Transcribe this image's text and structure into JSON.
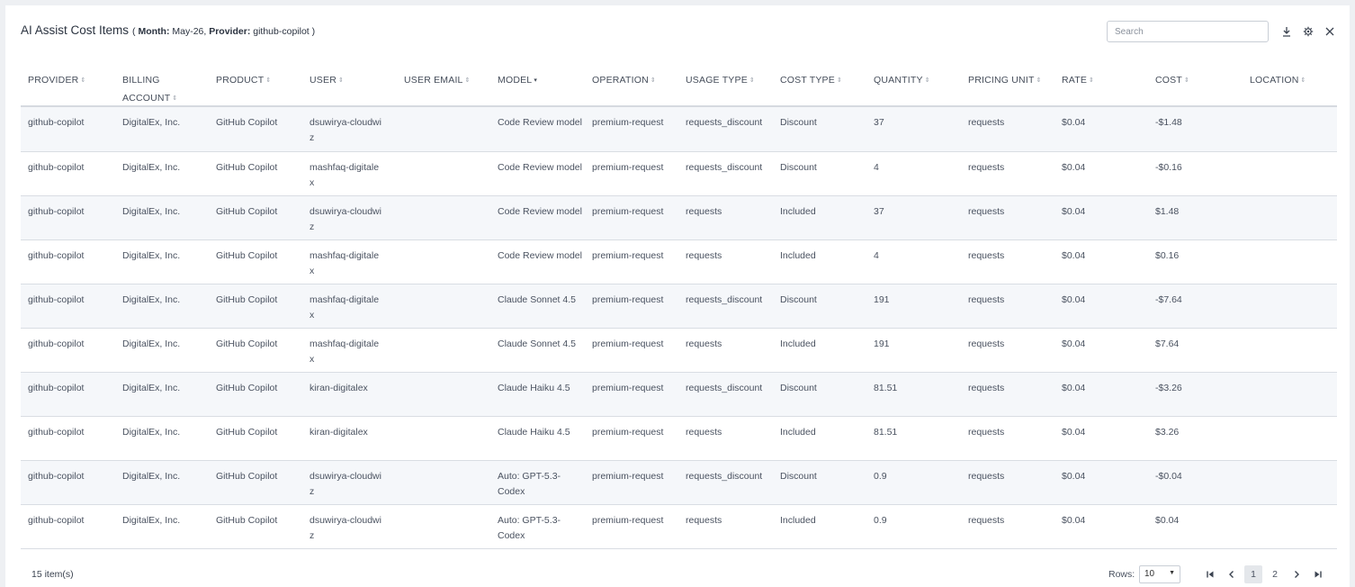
{
  "header": {
    "title": "AI Assist Cost Items",
    "open_paren": "(",
    "month_label": "Month:",
    "month_value": "May-26,",
    "provider_label": "Provider:",
    "provider_value": "github-copilot",
    "close_paren": ")",
    "search_placeholder": "Search",
    "icons": [
      "download-icon",
      "gear-icon",
      "close-icon"
    ]
  },
  "columns": [
    {
      "key": "provider",
      "label": "PROVIDER"
    },
    {
      "key": "billing_account",
      "label": "BILLING ACCOUNT"
    },
    {
      "key": "product",
      "label": "PRODUCT"
    },
    {
      "key": "user",
      "label": "USER"
    },
    {
      "key": "user_email",
      "label": "USER EMAIL"
    },
    {
      "key": "model",
      "label": "MODEL",
      "sorted": "desc"
    },
    {
      "key": "operation",
      "label": "OPERATION"
    },
    {
      "key": "usage_type",
      "label": "USAGE TYPE"
    },
    {
      "key": "cost_type",
      "label": "COST TYPE"
    },
    {
      "key": "quantity",
      "label": "QUANTITY"
    },
    {
      "key": "pricing_unit",
      "label": "PRICING UNIT"
    },
    {
      "key": "rate",
      "label": "RATE"
    },
    {
      "key": "cost",
      "label": "COST"
    },
    {
      "key": "location",
      "label": "LOCATION"
    }
  ],
  "rows": [
    {
      "provider": "github-copilot",
      "billing_account": "DigitalEx, Inc.",
      "product": "GitHub Copilot",
      "user": "dsuwirya-cloudwiz",
      "user_email": "",
      "model": "Code Review model",
      "operation": "premium-request",
      "usage_type": "requests_discount",
      "cost_type": "Discount",
      "quantity": "37",
      "pricing_unit": "requests",
      "rate": "$0.04",
      "cost": "-$1.48",
      "location": ""
    },
    {
      "provider": "github-copilot",
      "billing_account": "DigitalEx, Inc.",
      "product": "GitHub Copilot",
      "user": "mashfaq-digitalex",
      "user_email": "",
      "model": "Code Review model",
      "operation": "premium-request",
      "usage_type": "requests_discount",
      "cost_type": "Discount",
      "quantity": "4",
      "pricing_unit": "requests",
      "rate": "$0.04",
      "cost": "-$0.16",
      "location": ""
    },
    {
      "provider": "github-copilot",
      "billing_account": "DigitalEx, Inc.",
      "product": "GitHub Copilot",
      "user": "dsuwirya-cloudwiz",
      "user_email": "",
      "model": "Code Review model",
      "operation": "premium-request",
      "usage_type": "requests",
      "cost_type": "Included",
      "quantity": "37",
      "pricing_unit": "requests",
      "rate": "$0.04",
      "cost": "$1.48",
      "location": ""
    },
    {
      "provider": "github-copilot",
      "billing_account": "DigitalEx, Inc.",
      "product": "GitHub Copilot",
      "user": "mashfaq-digitalex",
      "user_email": "",
      "model": "Code Review model",
      "operation": "premium-request",
      "usage_type": "requests",
      "cost_type": "Included",
      "quantity": "4",
      "pricing_unit": "requests",
      "rate": "$0.04",
      "cost": "$0.16",
      "location": ""
    },
    {
      "provider": "github-copilot",
      "billing_account": "DigitalEx, Inc.",
      "product": "GitHub Copilot",
      "user": "mashfaq-digitalex",
      "user_email": "",
      "model": "Claude Sonnet 4.5",
      "operation": "premium-request",
      "usage_type": "requests_discount",
      "cost_type": "Discount",
      "quantity": "191",
      "pricing_unit": "requests",
      "rate": "$0.04",
      "cost": "-$7.64",
      "location": ""
    },
    {
      "provider": "github-copilot",
      "billing_account": "DigitalEx, Inc.",
      "product": "GitHub Copilot",
      "user": "mashfaq-digitalex",
      "user_email": "",
      "model": "Claude Sonnet 4.5",
      "operation": "premium-request",
      "usage_type": "requests",
      "cost_type": "Included",
      "quantity": "191",
      "pricing_unit": "requests",
      "rate": "$0.04",
      "cost": "$7.64",
      "location": ""
    },
    {
      "provider": "github-copilot",
      "billing_account": "DigitalEx, Inc.",
      "product": "GitHub Copilot",
      "user": "kiran-digitalex",
      "user_email": "",
      "model": "Claude Haiku 4.5",
      "operation": "premium-request",
      "usage_type": "requests_discount",
      "cost_type": "Discount",
      "quantity": "81.51",
      "pricing_unit": "requests",
      "rate": "$0.04",
      "cost": "-$3.26",
      "location": ""
    },
    {
      "provider": "github-copilot",
      "billing_account": "DigitalEx, Inc.",
      "product": "GitHub Copilot",
      "user": "kiran-digitalex",
      "user_email": "",
      "model": "Claude Haiku 4.5",
      "operation": "premium-request",
      "usage_type": "requests",
      "cost_type": "Included",
      "quantity": "81.51",
      "pricing_unit": "requests",
      "rate": "$0.04",
      "cost": "$3.26",
      "location": ""
    },
    {
      "provider": "github-copilot",
      "billing_account": "DigitalEx, Inc.",
      "product": "GitHub Copilot",
      "user": "dsuwirya-cloudwiz",
      "user_email": "",
      "model": "Auto: GPT-5.3-Codex",
      "operation": "premium-request",
      "usage_type": "requests_discount",
      "cost_type": "Discount",
      "quantity": "0.9",
      "pricing_unit": "requests",
      "rate": "$0.04",
      "cost": "-$0.04",
      "location": ""
    },
    {
      "provider": "github-copilot",
      "billing_account": "DigitalEx, Inc.",
      "product": "GitHub Copilot",
      "user": "dsuwirya-cloudwiz",
      "user_email": "",
      "model": "Auto: GPT-5.3-Codex",
      "operation": "premium-request",
      "usage_type": "requests",
      "cost_type": "Included",
      "quantity": "0.9",
      "pricing_unit": "requests",
      "rate": "$0.04",
      "cost": "$0.04",
      "location": ""
    }
  ],
  "footer": {
    "item_count": "15 item(s)",
    "rows_label": "Rows:",
    "rows_value": "10",
    "pages": [
      "1",
      "2"
    ],
    "current_page": "1"
  }
}
